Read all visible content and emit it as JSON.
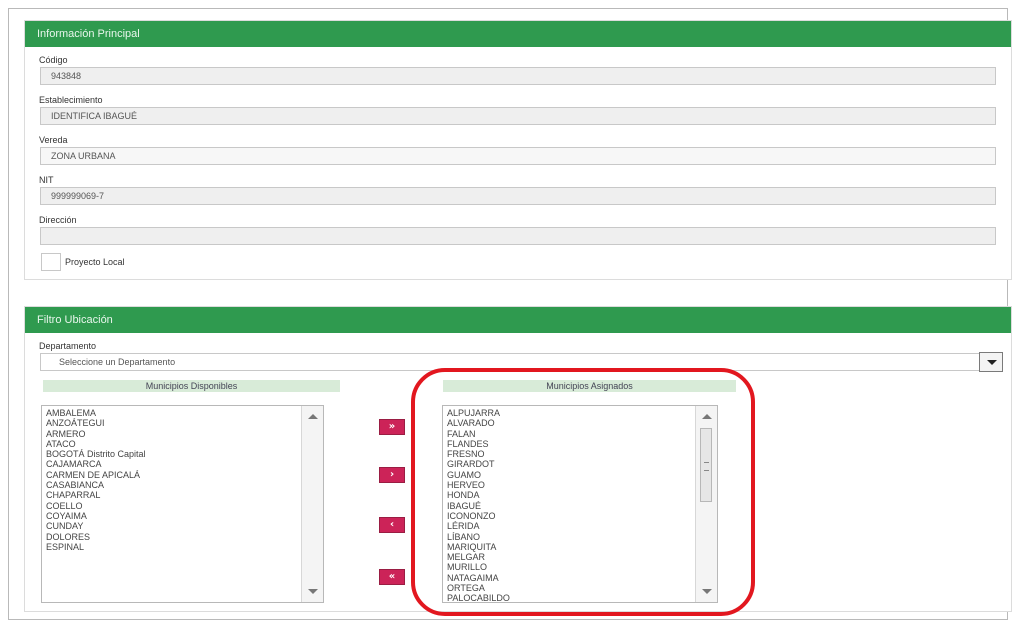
{
  "main_panel": {
    "title": "Información Principal",
    "codigo_label": "Código",
    "codigo_value": "943848",
    "establecimiento_label": "Establecimiento",
    "establecimiento_value": "IDENTIFICA IBAGUÉ",
    "vereda_label": "Vereda",
    "vereda_value": "ZONA URBANA",
    "nit_label": "NIT",
    "nit_value": "999999069-7",
    "direccion_label": "Dirección",
    "direccion_value": "",
    "checkbox_label": "Proyecto Local"
  },
  "filter_panel": {
    "title": "Filtro Ubicación",
    "departamento_label": "Departamento",
    "departamento_value": "Seleccione un Departamento",
    "disponibles_title": "Municipios Disponibles",
    "asignados_title": "Municipios Asignados",
    "disponibles": [
      "AMBALEMA",
      "ANZOÁTEGUI",
      "ARMERO",
      "ATACO",
      "BOGOTÁ Distrito Capital",
      "CAJAMARCA",
      "CARMEN DE APICALÁ",
      "CASABIANCA",
      "CHAPARRAL",
      "COELLO",
      "COYAIMA",
      "CUNDAY",
      "DOLORES",
      "ESPINAL"
    ],
    "asignados": [
      "ALPUJARRA",
      "ALVARADO",
      "FALAN",
      "FLANDES",
      "FRESNO",
      "GIRARDOT",
      "GUAMO",
      "HERVEO",
      "HONDA",
      "IBAGUÉ",
      "ICONONZO",
      "LÉRIDA",
      "LÍBANO",
      "MARIQUITA",
      "MELGAR",
      "MURILLO",
      "NATAGAIMA",
      "ORTEGA",
      "PALOCABILDO"
    ],
    "btn_add_all": "»",
    "btn_add": "›",
    "btn_remove": "‹",
    "btn_remove_all": "«"
  },
  "colors": {
    "header_green": "#2f9a4f",
    "list_title_bg": "#d8ebd8",
    "transfer_button": "#cc2358",
    "highlight_red": "#e2171f"
  }
}
